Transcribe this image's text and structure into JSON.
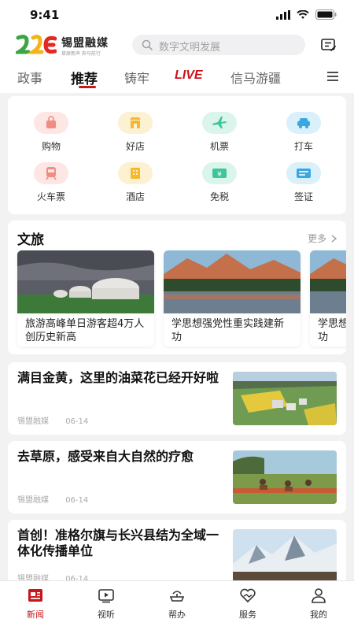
{
  "status_bar": {
    "time": "9:41"
  },
  "header": {
    "logo_text": "锡盟融媒",
    "logo_sub": "草原新声 奔马前行",
    "search_placeholder": "数字文明发展"
  },
  "tabs": [
    {
      "label": "政事"
    },
    {
      "label": "推荐",
      "active": true
    },
    {
      "label": "铸牢"
    },
    {
      "label": "LIVE"
    },
    {
      "label": "信马游疆"
    }
  ],
  "services": [
    {
      "label": "购物",
      "icon": "shopping-bag-icon",
      "color": "#f7a69f"
    },
    {
      "label": "好店",
      "icon": "shop-icon",
      "color": "#f6c34d"
    },
    {
      "label": "机票",
      "icon": "airplane-icon",
      "color": "#4fcfa9"
    },
    {
      "label": "打车",
      "icon": "taxi-icon",
      "color": "#46b6e8"
    },
    {
      "label": "火车票",
      "icon": "train-icon",
      "color": "#f7a69f"
    },
    {
      "label": "酒店",
      "icon": "hotel-icon",
      "color": "#f6c34d"
    },
    {
      "label": "免税",
      "icon": "duty-free-icon",
      "color": "#4fcfa9"
    },
    {
      "label": "签证",
      "icon": "visa-icon",
      "color": "#46b6e8"
    }
  ],
  "culture": {
    "title": "文旅",
    "more": "更多",
    "cards": [
      {
        "title": "旅游高峰单日游客超4万人创历史新高",
        "image": "yurt-landscape"
      },
      {
        "title": "学思想强党性重实践建新功",
        "image": "mountain-lake"
      },
      {
        "title": "学思想强党性重实践建新功",
        "image": "mountain-lake"
      }
    ]
  },
  "news": [
    {
      "title": "满目金黄，这里的油菜花已经开好啦",
      "source": "锡盟融媒",
      "date": "06-14",
      "image": "village-aerial"
    },
    {
      "title": "去草原，感受来自大自然的疗愈",
      "source": "锡盟融媒",
      "date": "06-14",
      "image": "grassland-riders"
    },
    {
      "title": "首创！准格尔旗与长兴县结为全域一体化传播单位",
      "source": "锡盟融媒",
      "date": "06-14",
      "image": "snow-mountain"
    }
  ],
  "bottom_nav": [
    {
      "label": "新闻",
      "icon": "news-icon",
      "active": true
    },
    {
      "label": "视听",
      "icon": "video-icon"
    },
    {
      "label": "帮办",
      "icon": "help-icon"
    },
    {
      "label": "服务",
      "icon": "service-icon"
    },
    {
      "label": "我的",
      "icon": "profile-icon"
    }
  ],
  "colors": {
    "accent": "#c8161d",
    "background": "#f2f2f2"
  }
}
